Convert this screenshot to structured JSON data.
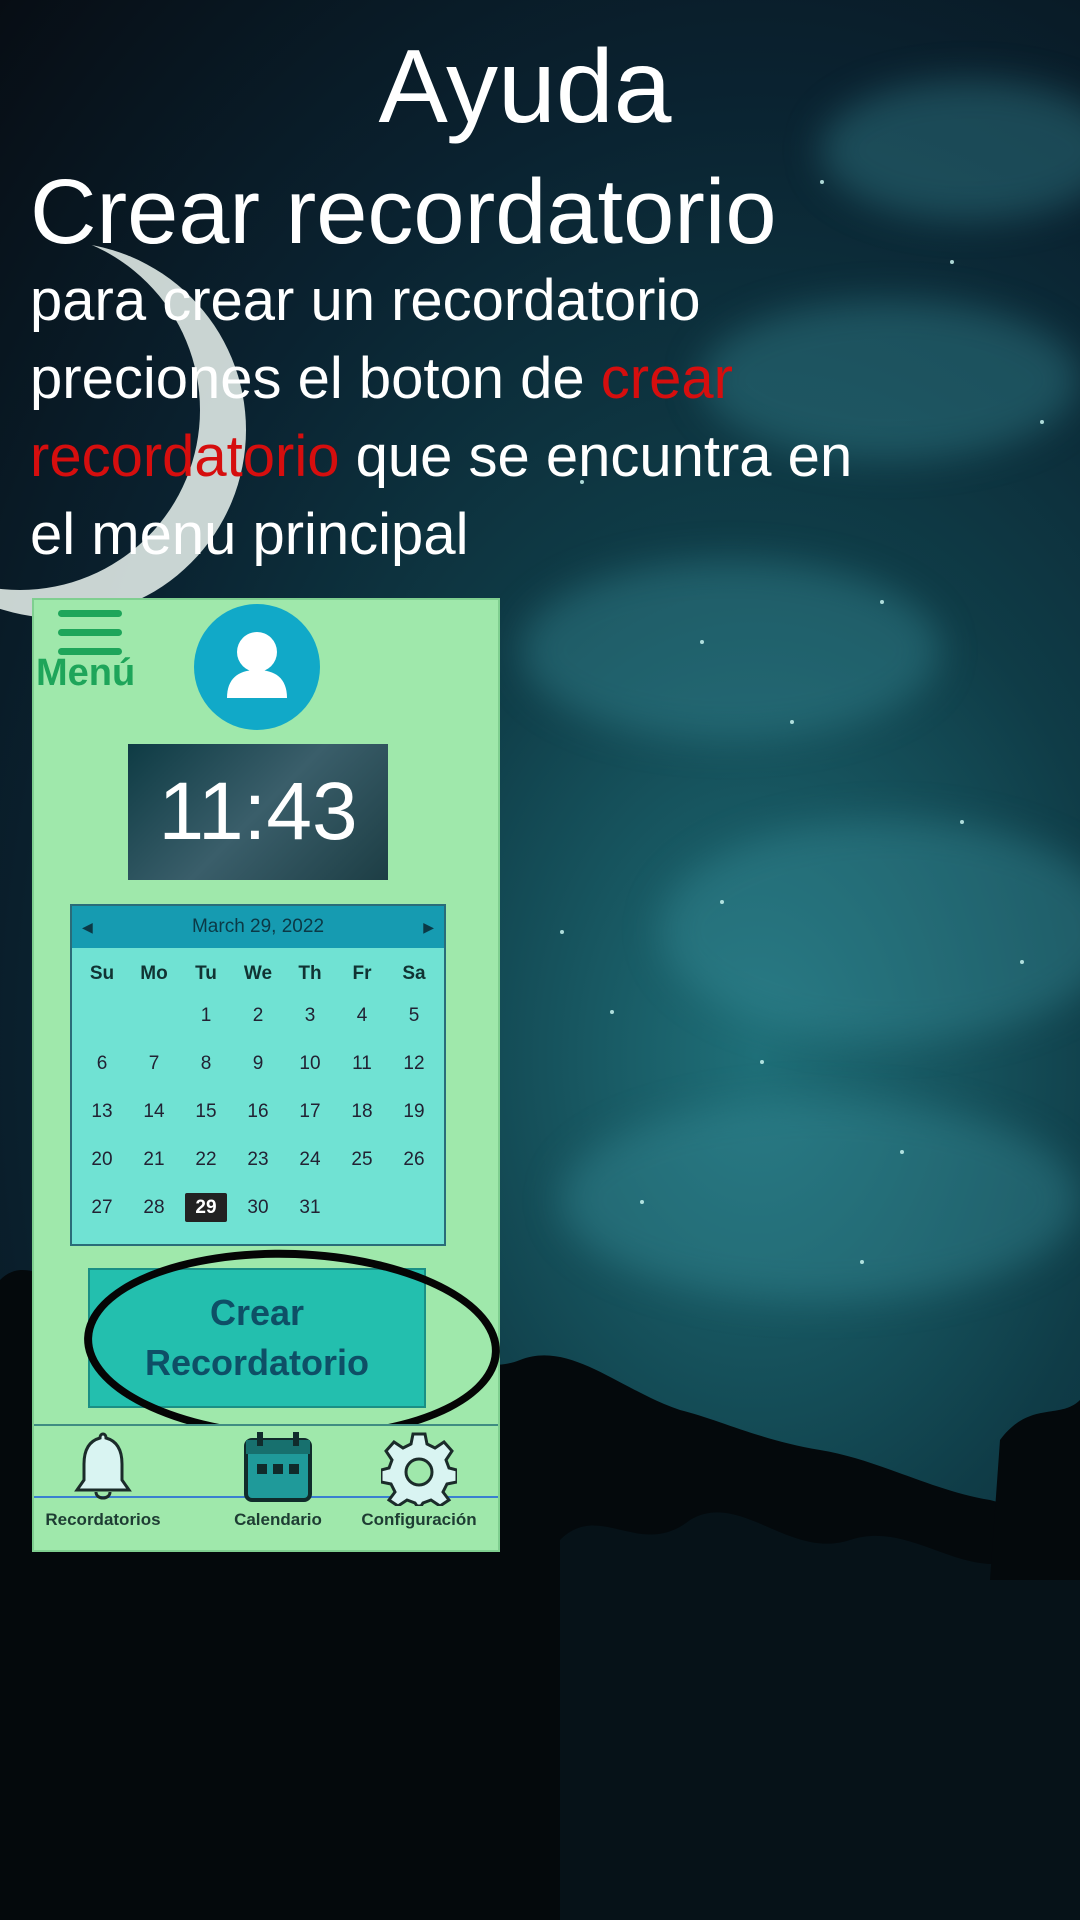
{
  "page": {
    "title": "Ayuda",
    "section_title": "Crear recordatorio",
    "description_part1": "para crear un recordatorio preciones el boton de ",
    "description_highlight": "crear recordatorio",
    "description_part2": " que se encuntra en el menu principal"
  },
  "colors": {
    "highlight": "#d60e0e",
    "app_background": "#9fe8ab",
    "menu_green": "#1ea55a",
    "calendar_bg": "#70e2d3",
    "calendar_header": "#169bb1",
    "button_bg": "#23bfae"
  },
  "app": {
    "menu_label": "Menú",
    "menu_icon": "hamburger-icon",
    "avatar_icon": "user-icon",
    "clock_time": "11:43",
    "calendar": {
      "header": "March 29, 2022",
      "prev_icon": "chevron-left-icon",
      "next_icon": "chevron-right-icon",
      "weekdays": [
        "Su",
        "Mo",
        "Tu",
        "We",
        "Th",
        "Fr",
        "Sa"
      ],
      "weeks": [
        [
          "",
          "",
          "1",
          "2",
          "3",
          "4",
          "5"
        ],
        [
          "6",
          "7",
          "8",
          "9",
          "10",
          "11",
          "12"
        ],
        [
          "13",
          "14",
          "15",
          "16",
          "17",
          "18",
          "19"
        ],
        [
          "20",
          "21",
          "22",
          "23",
          "24",
          "25",
          "26"
        ],
        [
          "27",
          "28",
          "29",
          "30",
          "31",
          "",
          ""
        ]
      ],
      "selected_day": "29"
    },
    "create_button_line1": "Crear",
    "create_button_line2": "Recordatorio",
    "nav": {
      "reminders_label": "Recordatorios",
      "reminders_icon": "bell-icon",
      "calendar_label": "Calendario",
      "calendar_icon": "calendar-icon",
      "settings_label": "Configuración",
      "settings_icon": "gear-icon"
    }
  }
}
